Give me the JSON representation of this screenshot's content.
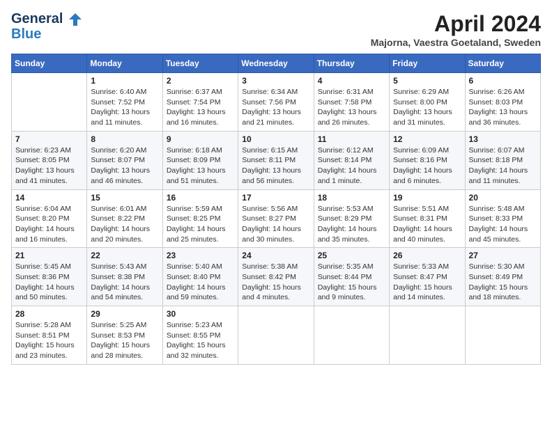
{
  "header": {
    "logo_line1": "General",
    "logo_line2": "Blue",
    "month_title": "April 2024",
    "location": "Majorna, Vaestra Goetaland, Sweden"
  },
  "weekdays": [
    "Sunday",
    "Monday",
    "Tuesday",
    "Wednesday",
    "Thursday",
    "Friday",
    "Saturday"
  ],
  "weeks": [
    [
      {
        "day": "",
        "sunrise": "",
        "sunset": "",
        "daylight": ""
      },
      {
        "day": "1",
        "sunrise": "Sunrise: 6:40 AM",
        "sunset": "Sunset: 7:52 PM",
        "daylight": "Daylight: 13 hours and 11 minutes."
      },
      {
        "day": "2",
        "sunrise": "Sunrise: 6:37 AM",
        "sunset": "Sunset: 7:54 PM",
        "daylight": "Daylight: 13 hours and 16 minutes."
      },
      {
        "day": "3",
        "sunrise": "Sunrise: 6:34 AM",
        "sunset": "Sunset: 7:56 PM",
        "daylight": "Daylight: 13 hours and 21 minutes."
      },
      {
        "day": "4",
        "sunrise": "Sunrise: 6:31 AM",
        "sunset": "Sunset: 7:58 PM",
        "daylight": "Daylight: 13 hours and 26 minutes."
      },
      {
        "day": "5",
        "sunrise": "Sunrise: 6:29 AM",
        "sunset": "Sunset: 8:00 PM",
        "daylight": "Daylight: 13 hours and 31 minutes."
      },
      {
        "day": "6",
        "sunrise": "Sunrise: 6:26 AM",
        "sunset": "Sunset: 8:03 PM",
        "daylight": "Daylight: 13 hours and 36 minutes."
      }
    ],
    [
      {
        "day": "7",
        "sunrise": "Sunrise: 6:23 AM",
        "sunset": "Sunset: 8:05 PM",
        "daylight": "Daylight: 13 hours and 41 minutes."
      },
      {
        "day": "8",
        "sunrise": "Sunrise: 6:20 AM",
        "sunset": "Sunset: 8:07 PM",
        "daylight": "Daylight: 13 hours and 46 minutes."
      },
      {
        "day": "9",
        "sunrise": "Sunrise: 6:18 AM",
        "sunset": "Sunset: 8:09 PM",
        "daylight": "Daylight: 13 hours and 51 minutes."
      },
      {
        "day": "10",
        "sunrise": "Sunrise: 6:15 AM",
        "sunset": "Sunset: 8:11 PM",
        "daylight": "Daylight: 13 hours and 56 minutes."
      },
      {
        "day": "11",
        "sunrise": "Sunrise: 6:12 AM",
        "sunset": "Sunset: 8:14 PM",
        "daylight": "Daylight: 14 hours and 1 minute."
      },
      {
        "day": "12",
        "sunrise": "Sunrise: 6:09 AM",
        "sunset": "Sunset: 8:16 PM",
        "daylight": "Daylight: 14 hours and 6 minutes."
      },
      {
        "day": "13",
        "sunrise": "Sunrise: 6:07 AM",
        "sunset": "Sunset: 8:18 PM",
        "daylight": "Daylight: 14 hours and 11 minutes."
      }
    ],
    [
      {
        "day": "14",
        "sunrise": "Sunrise: 6:04 AM",
        "sunset": "Sunset: 8:20 PM",
        "daylight": "Daylight: 14 hours and 16 minutes."
      },
      {
        "day": "15",
        "sunrise": "Sunrise: 6:01 AM",
        "sunset": "Sunset: 8:22 PM",
        "daylight": "Daylight: 14 hours and 20 minutes."
      },
      {
        "day": "16",
        "sunrise": "Sunrise: 5:59 AM",
        "sunset": "Sunset: 8:25 PM",
        "daylight": "Daylight: 14 hours and 25 minutes."
      },
      {
        "day": "17",
        "sunrise": "Sunrise: 5:56 AM",
        "sunset": "Sunset: 8:27 PM",
        "daylight": "Daylight: 14 hours and 30 minutes."
      },
      {
        "day": "18",
        "sunrise": "Sunrise: 5:53 AM",
        "sunset": "Sunset: 8:29 PM",
        "daylight": "Daylight: 14 hours and 35 minutes."
      },
      {
        "day": "19",
        "sunrise": "Sunrise: 5:51 AM",
        "sunset": "Sunset: 8:31 PM",
        "daylight": "Daylight: 14 hours and 40 minutes."
      },
      {
        "day": "20",
        "sunrise": "Sunrise: 5:48 AM",
        "sunset": "Sunset: 8:33 PM",
        "daylight": "Daylight: 14 hours and 45 minutes."
      }
    ],
    [
      {
        "day": "21",
        "sunrise": "Sunrise: 5:45 AM",
        "sunset": "Sunset: 8:36 PM",
        "daylight": "Daylight: 14 hours and 50 minutes."
      },
      {
        "day": "22",
        "sunrise": "Sunrise: 5:43 AM",
        "sunset": "Sunset: 8:38 PM",
        "daylight": "Daylight: 14 hours and 54 minutes."
      },
      {
        "day": "23",
        "sunrise": "Sunrise: 5:40 AM",
        "sunset": "Sunset: 8:40 PM",
        "daylight": "Daylight: 14 hours and 59 minutes."
      },
      {
        "day": "24",
        "sunrise": "Sunrise: 5:38 AM",
        "sunset": "Sunset: 8:42 PM",
        "daylight": "Daylight: 15 hours and 4 minutes."
      },
      {
        "day": "25",
        "sunrise": "Sunrise: 5:35 AM",
        "sunset": "Sunset: 8:44 PM",
        "daylight": "Daylight: 15 hours and 9 minutes."
      },
      {
        "day": "26",
        "sunrise": "Sunrise: 5:33 AM",
        "sunset": "Sunset: 8:47 PM",
        "daylight": "Daylight: 15 hours and 14 minutes."
      },
      {
        "day": "27",
        "sunrise": "Sunrise: 5:30 AM",
        "sunset": "Sunset: 8:49 PM",
        "daylight": "Daylight: 15 hours and 18 minutes."
      }
    ],
    [
      {
        "day": "28",
        "sunrise": "Sunrise: 5:28 AM",
        "sunset": "Sunset: 8:51 PM",
        "daylight": "Daylight: 15 hours and 23 minutes."
      },
      {
        "day": "29",
        "sunrise": "Sunrise: 5:25 AM",
        "sunset": "Sunset: 8:53 PM",
        "daylight": "Daylight: 15 hours and 28 minutes."
      },
      {
        "day": "30",
        "sunrise": "Sunrise: 5:23 AM",
        "sunset": "Sunset: 8:55 PM",
        "daylight": "Daylight: 15 hours and 32 minutes."
      },
      {
        "day": "",
        "sunrise": "",
        "sunset": "",
        "daylight": ""
      },
      {
        "day": "",
        "sunrise": "",
        "sunset": "",
        "daylight": ""
      },
      {
        "day": "",
        "sunrise": "",
        "sunset": "",
        "daylight": ""
      },
      {
        "day": "",
        "sunrise": "",
        "sunset": "",
        "daylight": ""
      }
    ]
  ]
}
